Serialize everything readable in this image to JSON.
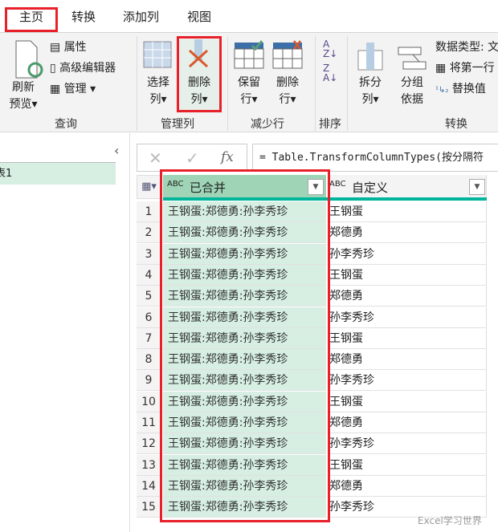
{
  "tabs": [
    "主页",
    "转换",
    "添加列",
    "视图"
  ],
  "ribbon": {
    "refresh": [
      "刷新",
      "预览"
    ],
    "properties": "属性",
    "advanced_editor": "高级编辑器",
    "manage": "管理",
    "choose_cols": [
      "选择",
      "列"
    ],
    "remove_cols": [
      "删除",
      "列"
    ],
    "keep_rows": [
      "保留",
      "行"
    ],
    "remove_rows": [
      "删除",
      "行"
    ],
    "split": [
      "拆分",
      "列"
    ],
    "group_by": [
      "分组",
      "依据"
    ],
    "data_type": "数据类型: 文",
    "first_row": "将第一行",
    "replace": "替换值",
    "groups": [
      "查询",
      "管理列",
      "减少行",
      "排序",
      "转换"
    ]
  },
  "left_panel": {
    "query": "表1"
  },
  "formula": {
    "text": "= Table.TransformColumnTypes(按分隔符",
    "fx": "fx"
  },
  "table": {
    "columns": [
      {
        "type": "ABC",
        "name": "已合并"
      },
      {
        "type": "ABC",
        "name": "自定义"
      }
    ],
    "rows": [
      [
        "1",
        "王钢蛋:郑德勇:孙李秀珍",
        "王钢蛋"
      ],
      [
        "2",
        "王钢蛋:郑德勇:孙李秀珍",
        "郑德勇"
      ],
      [
        "3",
        "王钢蛋:郑德勇:孙李秀珍",
        "孙李秀珍"
      ],
      [
        "4",
        "王钢蛋:郑德勇:孙李秀珍",
        "王钢蛋"
      ],
      [
        "5",
        "王钢蛋:郑德勇:孙李秀珍",
        "郑德勇"
      ],
      [
        "6",
        "王钢蛋:郑德勇:孙李秀珍",
        "孙李秀珍"
      ],
      [
        "7",
        "王钢蛋:郑德勇:孙李秀珍",
        "王钢蛋"
      ],
      [
        "8",
        "王钢蛋:郑德勇:孙李秀珍",
        "郑德勇"
      ],
      [
        "9",
        "王钢蛋:郑德勇:孙李秀珍",
        "孙李秀珍"
      ],
      [
        "10",
        "王钢蛋:郑德勇:孙李秀珍",
        "王钢蛋"
      ],
      [
        "11",
        "王钢蛋:郑德勇:孙李秀珍",
        "郑德勇"
      ],
      [
        "12",
        "王钢蛋:郑德勇:孙李秀珍",
        "孙李秀珍"
      ],
      [
        "13",
        "王钢蛋:郑德勇:孙李秀珍",
        "王钢蛋"
      ],
      [
        "14",
        "王钢蛋:郑德勇:孙李秀珍",
        "郑德勇"
      ],
      [
        "15",
        "王钢蛋:郑德勇:孙李秀珍",
        "孙李秀珍"
      ]
    ]
  },
  "watermark": "Excel学习世界",
  "colors": {
    "highlight": "#e8202a",
    "selected_col": "#d6efe2",
    "header_selected": "#9fd5b6",
    "quality_bar": "#00b59b"
  }
}
